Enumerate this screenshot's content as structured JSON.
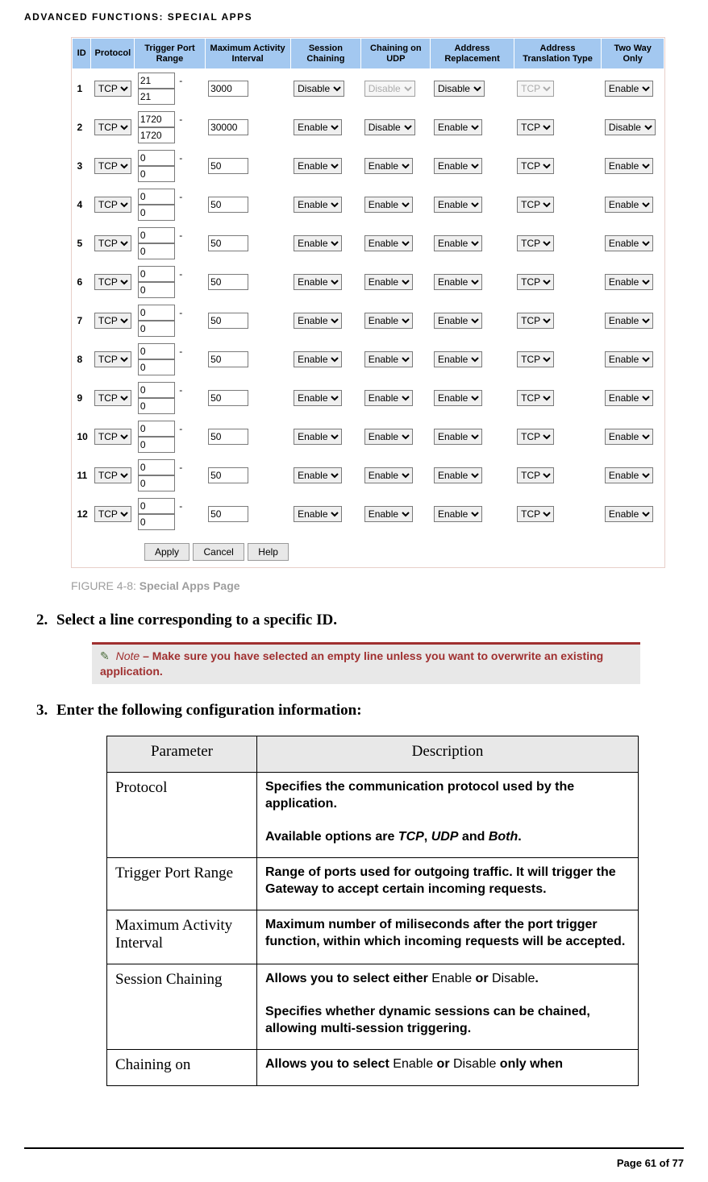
{
  "header": {
    "running": "ADVANCED FUNCTIONS: SPECIAL APPS"
  },
  "screenshot": {
    "columns": [
      "ID",
      "Protocol",
      "Trigger Port Range",
      "Maximum Activity Interval",
      "Session Chaining",
      "Chaining on UDP",
      "Address Replacement",
      "Address Translation Type",
      "Two Way Only"
    ],
    "rows": [
      {
        "id": "1",
        "protocol": "TCP",
        "port_from": "21",
        "port_to": "21",
        "max": "3000",
        "session": "Disable",
        "udp": "Disable",
        "udp_disabled": true,
        "addr": "Disable",
        "trans": "TCP",
        "trans_disabled": true,
        "two": "Enable"
      },
      {
        "id": "2",
        "protocol": "TCP",
        "port_from": "1720",
        "port_to": "1720",
        "max": "30000",
        "session": "Enable",
        "udp": "Disable",
        "udp_disabled": false,
        "addr": "Enable",
        "trans": "TCP",
        "trans_disabled": false,
        "two": "Disable"
      },
      {
        "id": "3",
        "protocol": "TCP",
        "port_from": "0",
        "port_to": "0",
        "max": "50",
        "session": "Enable",
        "udp": "Enable",
        "udp_disabled": false,
        "addr": "Enable",
        "trans": "TCP",
        "trans_disabled": false,
        "two": "Enable"
      },
      {
        "id": "4",
        "protocol": "TCP",
        "port_from": "0",
        "port_to": "0",
        "max": "50",
        "session": "Enable",
        "udp": "Enable",
        "udp_disabled": false,
        "addr": "Enable",
        "trans": "TCP",
        "trans_disabled": false,
        "two": "Enable"
      },
      {
        "id": "5",
        "protocol": "TCP",
        "port_from": "0",
        "port_to": "0",
        "max": "50",
        "session": "Enable",
        "udp": "Enable",
        "udp_disabled": false,
        "addr": "Enable",
        "trans": "TCP",
        "trans_disabled": false,
        "two": "Enable"
      },
      {
        "id": "6",
        "protocol": "TCP",
        "port_from": "0",
        "port_to": "0",
        "max": "50",
        "session": "Enable",
        "udp": "Enable",
        "udp_disabled": false,
        "addr": "Enable",
        "trans": "TCP",
        "trans_disabled": false,
        "two": "Enable"
      },
      {
        "id": "7",
        "protocol": "TCP",
        "port_from": "0",
        "port_to": "0",
        "max": "50",
        "session": "Enable",
        "udp": "Enable",
        "udp_disabled": false,
        "addr": "Enable",
        "trans": "TCP",
        "trans_disabled": false,
        "two": "Enable"
      },
      {
        "id": "8",
        "protocol": "TCP",
        "port_from": "0",
        "port_to": "0",
        "max": "50",
        "session": "Enable",
        "udp": "Enable",
        "udp_disabled": false,
        "addr": "Enable",
        "trans": "TCP",
        "trans_disabled": false,
        "two": "Enable"
      },
      {
        "id": "9",
        "protocol": "TCP",
        "port_from": "0",
        "port_to": "0",
        "max": "50",
        "session": "Enable",
        "udp": "Enable",
        "udp_disabled": false,
        "addr": "Enable",
        "trans": "TCP",
        "trans_disabled": false,
        "two": "Enable"
      },
      {
        "id": "10",
        "protocol": "TCP",
        "port_from": "0",
        "port_to": "0",
        "max": "50",
        "session": "Enable",
        "udp": "Enable",
        "udp_disabled": false,
        "addr": "Enable",
        "trans": "TCP",
        "trans_disabled": false,
        "two": "Enable"
      },
      {
        "id": "11",
        "protocol": "TCP",
        "port_from": "0",
        "port_to": "0",
        "max": "50",
        "session": "Enable",
        "udp": "Enable",
        "udp_disabled": false,
        "addr": "Enable",
        "trans": "TCP",
        "trans_disabled": false,
        "two": "Enable"
      },
      {
        "id": "12",
        "protocol": "TCP",
        "port_from": "0",
        "port_to": "0",
        "max": "50",
        "session": "Enable",
        "udp": "Enable",
        "udp_disabled": false,
        "addr": "Enable",
        "trans": "TCP",
        "trans_disabled": false,
        "two": "Enable"
      }
    ],
    "buttons": {
      "apply": "Apply",
      "cancel": "Cancel",
      "help": "Help"
    }
  },
  "figure": {
    "label": "FIGURE 4-8:",
    "title": "Special Apps Page"
  },
  "steps": {
    "s2": "Select a line corresponding to a specific ID.",
    "s3": "Enter the following configuration information:"
  },
  "note": {
    "word": "Note",
    "dash": "–",
    "text": "Make sure you have selected an empty line unless you want to overwrite an existing application."
  },
  "table": {
    "head_param": "Parameter",
    "head_desc": "Description",
    "rows": [
      {
        "param": "Protocol",
        "desc_html": "Specifies the communication protocol used by the application.<br><br>Available options are <span class=\"italic\">TCP</span>, <span class=\"italic\">UDP</span> and <span class=\"italic\">Both</span>."
      },
      {
        "param": "Trigger Port Range",
        "desc_html": "Range of ports used for outgoing traffic. It will trigger the Gateway to accept certain incoming requests."
      },
      {
        "param": "Maximum Activity Interval",
        "desc_html": "Maximum number of miliseconds after the port trigger function, within which incoming requests will be accepted."
      },
      {
        "param": "Session Chaining",
        "desc_html": "Allows you to select either <span class=\"plain\">Enable</span> or <span class=\"plain\">Disable</span>.<br><br>Specifies whether dynamic sessions can be chained, allowing multi-session triggering."
      },
      {
        "param": "Chaining on",
        "desc_html": "Allows you to select <span class=\"plain\">Enable</span> or <span class=\"plain\">Disable</span> only when"
      }
    ]
  },
  "footer": {
    "text": "Page 61 of 77"
  }
}
